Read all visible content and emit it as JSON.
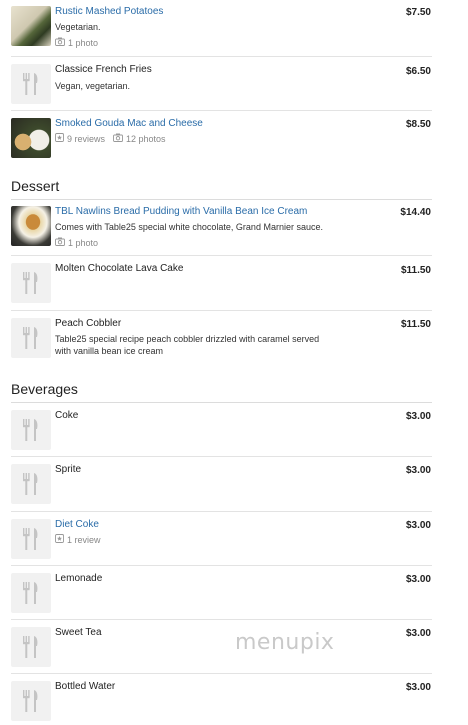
{
  "sides": [
    {
      "name": "Rustic Mashed Potatoes",
      "price": "$7.50",
      "desc": "Vegetarian.",
      "photos": "1 photo"
    },
    {
      "name": "Classice French Fries",
      "price": "$6.50",
      "desc": "Vegan, vegetarian."
    },
    {
      "name": "Smoked Gouda Mac and Cheese",
      "price": "$8.50",
      "reviews": "9 reviews",
      "photos": "12 photos"
    }
  ],
  "dessert": {
    "title": "Dessert",
    "items": [
      {
        "name": "TBL Nawlins Bread Pudding with Vanilla Bean Ice Cream",
        "price": "$14.40",
        "desc": "Comes with Table25 special white chocolate, Grand Marnier sauce.",
        "photos": "1 photo"
      },
      {
        "name": "Molten Chocolate Lava Cake",
        "price": "$11.50"
      },
      {
        "name": "Peach Cobbler",
        "price": "$11.50",
        "desc_line1": "Table25 special recipe peach cobbler drizzled with caramel served",
        "desc_line2": "with vanilla bean ice cream"
      }
    ]
  },
  "beverages": {
    "title": "Beverages",
    "items": [
      {
        "name": "Coke",
        "price": "$3.00"
      },
      {
        "name": "Sprite",
        "price": "$3.00"
      },
      {
        "name": "Diet Coke",
        "price": "$3.00",
        "reviews": "1 review"
      },
      {
        "name": "Lemonade",
        "price": "$3.00"
      },
      {
        "name": "Sweet Tea",
        "price": "$3.00"
      },
      {
        "name": "Bottled Water",
        "price": "$3.00"
      }
    ]
  },
  "watermark": "menupix",
  "colors": {
    "link": "#2a6ca8",
    "text": "#222222",
    "muted": "#888888",
    "divider": "#e3e3e3"
  },
  "icons": {
    "placeholder": "fork-knife-icon",
    "photo": "camera-icon",
    "review": "review-icon"
  }
}
